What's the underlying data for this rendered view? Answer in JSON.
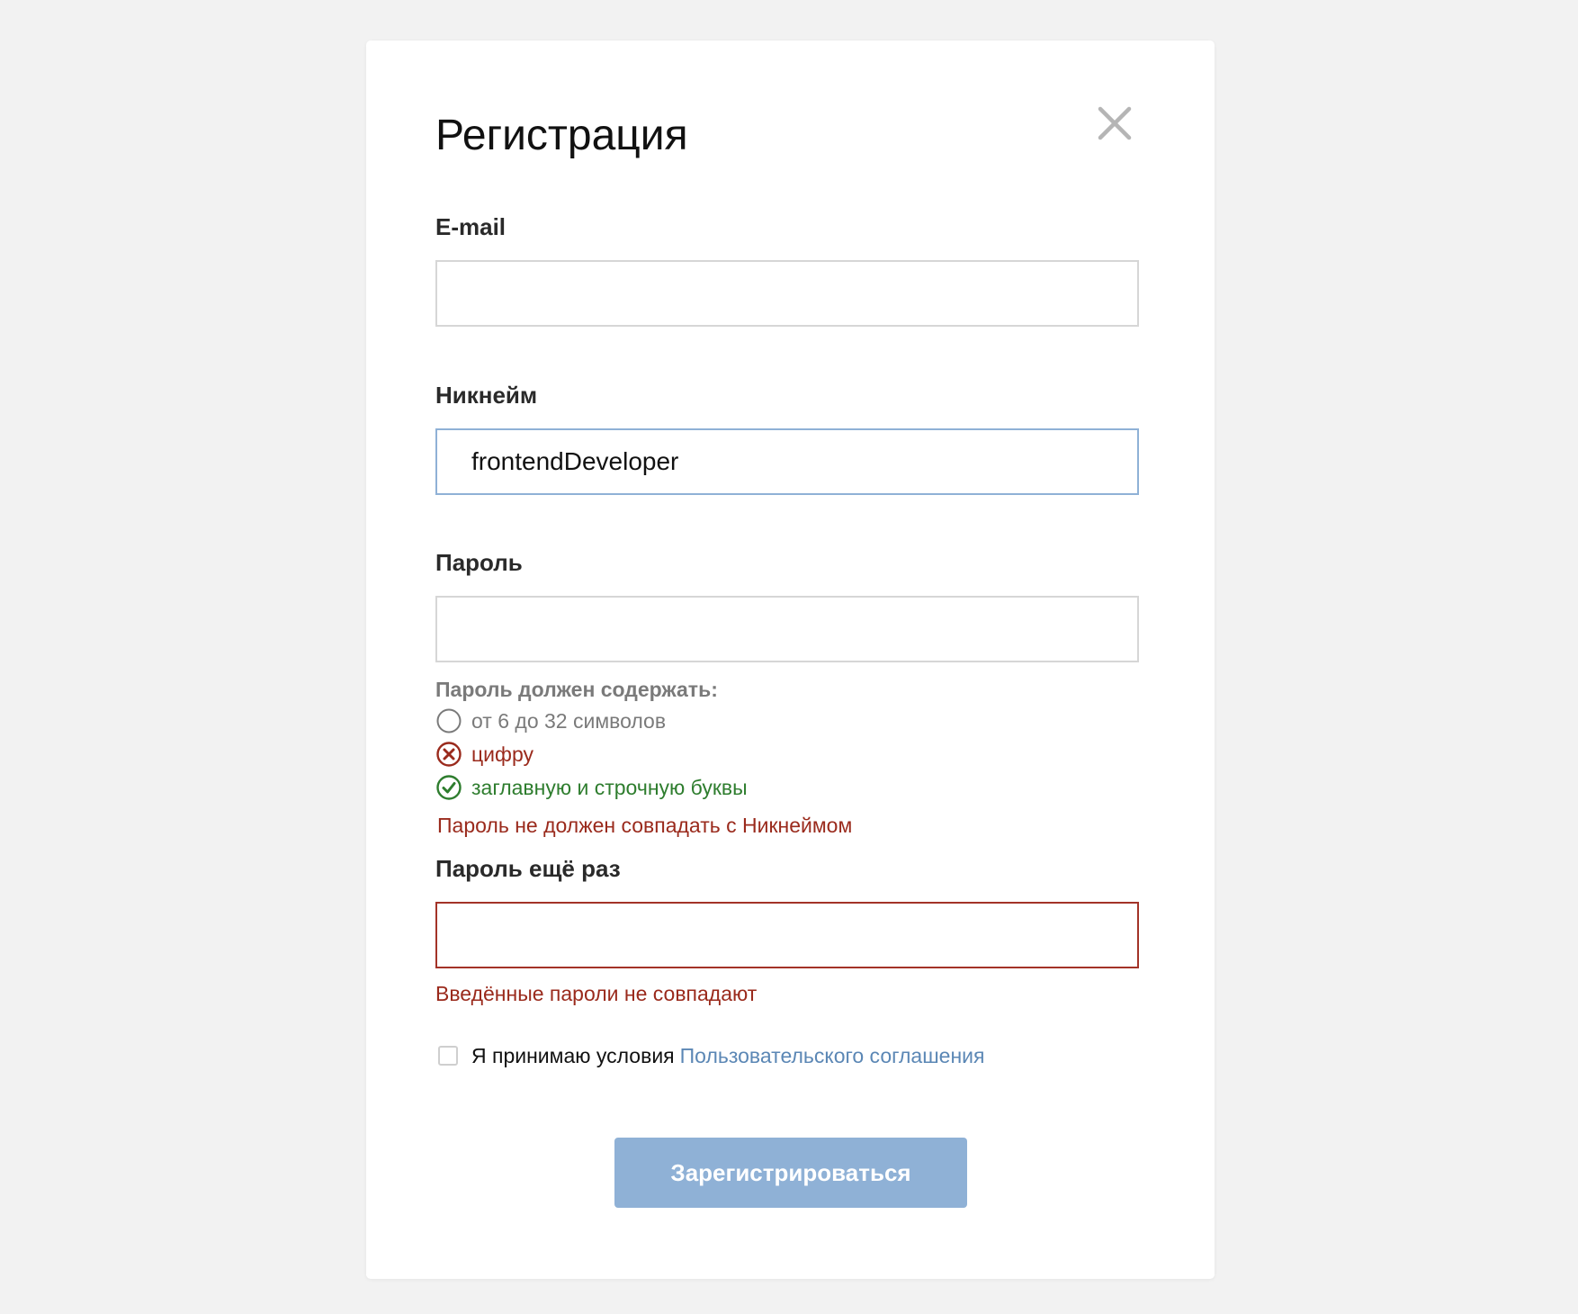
{
  "dialog": {
    "title": "Регистрация"
  },
  "email": {
    "label": "E-mail",
    "value": "",
    "placeholder": ""
  },
  "nickname": {
    "label": "Никнейм",
    "value": "frontendDeveloper",
    "state": "focused"
  },
  "password": {
    "label": "Пароль",
    "value": "",
    "requirements_title": "Пароль должен содержать:",
    "requirements": [
      {
        "text": "от 6 до 32 символов",
        "status": "neutral",
        "icon": "empty-circle-icon"
      },
      {
        "text": "цифру",
        "status": "fail",
        "icon": "x-circle-icon"
      },
      {
        "text": "заглавную и строчную буквы",
        "status": "ok",
        "icon": "check-circle-icon"
      }
    ],
    "error": "Пароль не должен совпадать с Никнеймом"
  },
  "password_repeat": {
    "label": "Пароль ещё раз",
    "value": "",
    "error": "Введённые пароли не совпадают"
  },
  "agreement": {
    "text": "Я принимаю условия",
    "link_text": "Пользовательского соглашения",
    "checked": false
  },
  "submit": {
    "label": "Зарегистрироваться"
  },
  "colors": {
    "background": "#f2f2f2",
    "accent": "#8fb1d6",
    "link": "#5b87b5",
    "error": "#9a2a1c",
    "success": "#2e7d2e",
    "muted": "#7a7a7a"
  }
}
